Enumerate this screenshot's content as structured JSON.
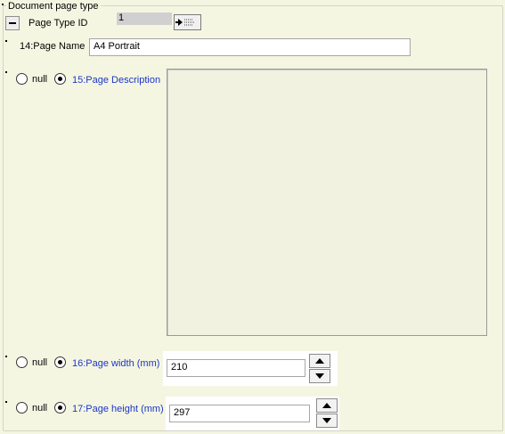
{
  "group": {
    "title": "Document page type"
  },
  "page_type_id": {
    "label": "Page Type ID",
    "value": "1"
  },
  "page_name": {
    "label": "14:Page Name",
    "value": "A4 Portrait"
  },
  "page_description": {
    "null_label": "null",
    "label": "15:Page Description",
    "value": "",
    "selected": "value"
  },
  "page_width": {
    "null_label": "null",
    "label": "16:Page width (mm)",
    "value": "210",
    "selected": "value"
  },
  "page_height": {
    "null_label": "null",
    "label": "17:Page height (mm)",
    "value": "297",
    "selected": "value"
  },
  "colors": {
    "background": "#f5f6e2",
    "field_label_blue": "#1a36c8",
    "textarea_bg": "#f1f2df"
  },
  "icons": {
    "collapse": "minus-icon",
    "goto": "arrow-right-icon",
    "spin_up": "triangle-up-icon",
    "spin_down": "triangle-down-icon"
  }
}
